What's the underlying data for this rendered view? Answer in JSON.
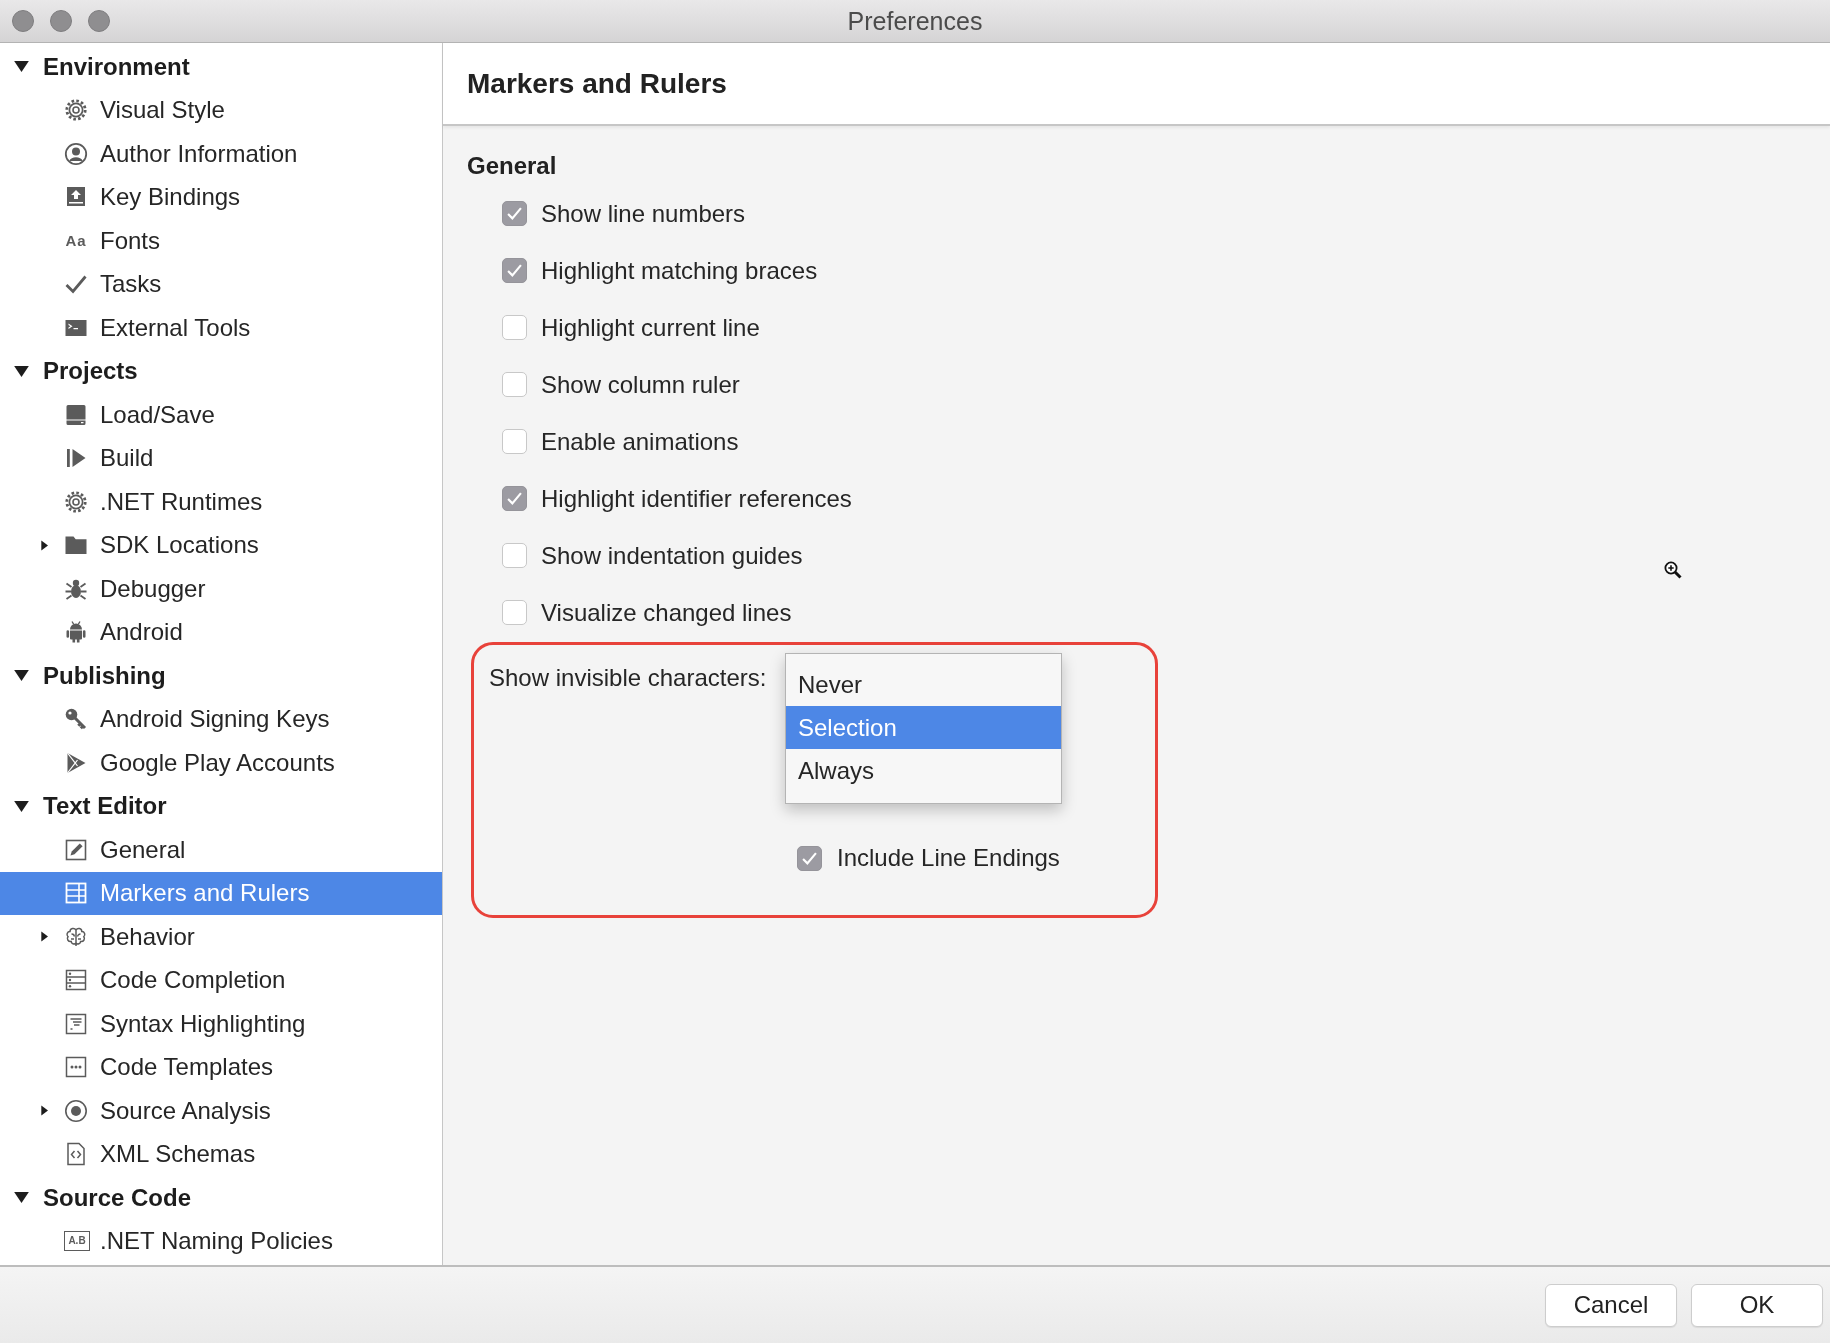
{
  "window": {
    "title": "Preferences"
  },
  "sidebar": {
    "items": [
      {
        "label": "Environment",
        "expanded": true,
        "children": [
          {
            "label": "Visual Style",
            "kind": "leaf",
            "selected": false
          },
          {
            "label": "Author Information",
            "kind": "leaf",
            "selected": false
          },
          {
            "label": "Key Bindings",
            "kind": "leaf",
            "selected": false
          },
          {
            "label": "Fonts",
            "kind": "leaf",
            "selected": false,
            "glyph": "Aa"
          },
          {
            "label": "Tasks",
            "kind": "leaf",
            "selected": false
          },
          {
            "label": "External Tools",
            "kind": "leaf",
            "selected": false
          }
        ]
      },
      {
        "label": "Projects",
        "expanded": true,
        "children": [
          {
            "label": "Load/Save",
            "kind": "leaf",
            "selected": false
          },
          {
            "label": "Build",
            "kind": "leaf",
            "selected": false
          },
          {
            "label": ".NET Runtimes",
            "kind": "leaf",
            "selected": false
          },
          {
            "label": "SDK Locations",
            "kind": "branch",
            "expanded": false,
            "selected": false
          },
          {
            "label": "Debugger",
            "kind": "leaf",
            "selected": false
          },
          {
            "label": "Android",
            "kind": "leaf",
            "selected": false
          }
        ]
      },
      {
        "label": "Publishing",
        "expanded": true,
        "children": [
          {
            "label": "Android Signing Keys",
            "kind": "leaf",
            "selected": false
          },
          {
            "label": "Google Play Accounts",
            "kind": "leaf",
            "selected": false
          }
        ]
      },
      {
        "label": "Text Editor",
        "expanded": true,
        "children": [
          {
            "label": "General",
            "kind": "leaf",
            "selected": false
          },
          {
            "label": "Markers and Rulers",
            "kind": "leaf",
            "selected": true
          },
          {
            "label": "Behavior",
            "kind": "branch",
            "expanded": false,
            "selected": false
          },
          {
            "label": "Code Completion",
            "kind": "leaf",
            "selected": false
          },
          {
            "label": "Syntax Highlighting",
            "kind": "leaf",
            "selected": false
          },
          {
            "label": "Code Templates",
            "kind": "leaf",
            "selected": false
          },
          {
            "label": "Source Analysis",
            "kind": "branch",
            "expanded": false,
            "selected": false
          },
          {
            "label": "XML Schemas",
            "kind": "leaf",
            "selected": false
          }
        ]
      },
      {
        "label": "Source Code",
        "expanded": true,
        "children": [
          {
            "label": ".NET Naming Policies",
            "kind": "leaf",
            "selected": false,
            "glyph": "A.B"
          }
        ]
      }
    ]
  },
  "panel": {
    "title": "Markers and Rulers",
    "section": "General",
    "options": [
      {
        "label": "Show line numbers",
        "checked": true
      },
      {
        "label": "Highlight matching braces",
        "checked": true
      },
      {
        "label": "Highlight current line",
        "checked": false
      },
      {
        "label": "Show column ruler",
        "checked": false
      },
      {
        "label": "Enable animations",
        "checked": false
      },
      {
        "label": "Highlight identifier references",
        "checked": true
      },
      {
        "label": "Show indentation guides",
        "checked": false
      },
      {
        "label": "Visualize changed lines",
        "checked": false
      }
    ]
  },
  "invisible_characters": {
    "label": "Show invisible characters:",
    "menu": [
      {
        "label": "Never",
        "selected": false
      },
      {
        "label": "Selection",
        "selected": true
      },
      {
        "label": "Always",
        "selected": false
      }
    ],
    "options": [
      {
        "label": "Include Line Endings",
        "checked": true
      }
    ]
  },
  "buttons": [
    "Cancel",
    "OK"
  ]
}
